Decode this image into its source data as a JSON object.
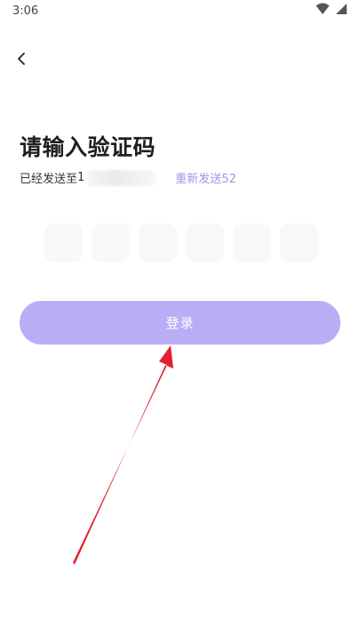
{
  "status_bar": {
    "time": "3:06"
  },
  "page": {
    "title": "请输入验证码",
    "sent_prefix": "已经发送至",
    "phone_visible": "1",
    "resend_label": "重新发送52"
  },
  "code_boxes": [
    "",
    "",
    "",
    "",
    "",
    ""
  ],
  "login_button": {
    "label": "登录"
  },
  "colors": {
    "accent": "#b9aef6",
    "resend_text": "#a293ea",
    "annotation_arrow": "#e02030"
  },
  "icons": {
    "back": "chevron-left-icon",
    "wifi": "wifi-icon",
    "signal": "signal-icon",
    "annotation": "red-arrow-annotation"
  }
}
